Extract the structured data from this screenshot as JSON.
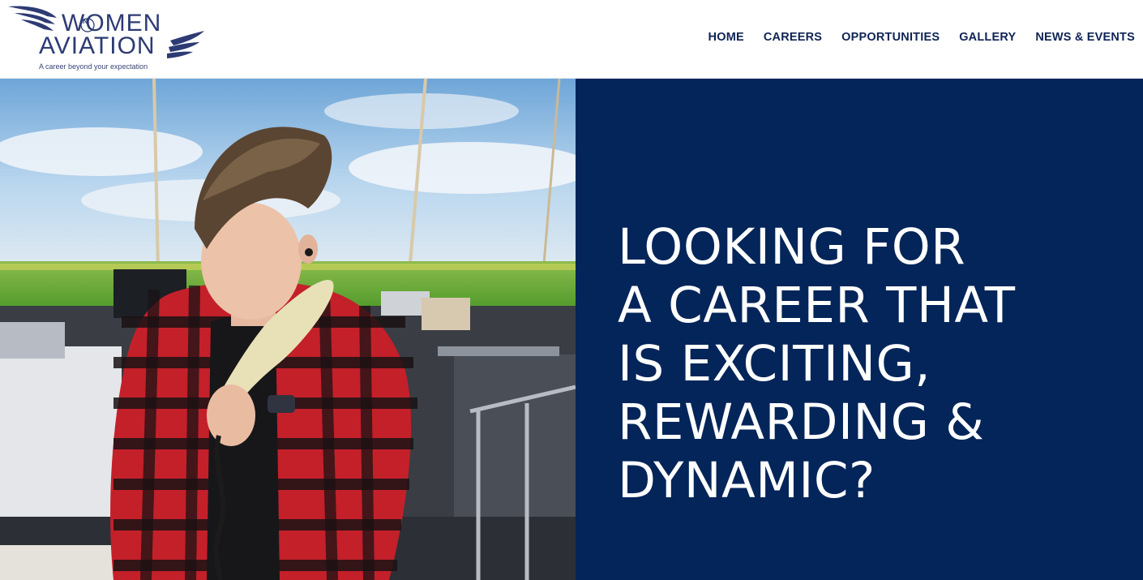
{
  "brand": {
    "line1": "WOMEN",
    "small": "IN",
    "line2": "AVIATION",
    "tagline": "A career beyond your expectation",
    "color": "#2d3b74"
  },
  "nav": {
    "items": [
      {
        "label": "HOME"
      },
      {
        "label": "CAREERS"
      },
      {
        "label": "OPPORTUNITIES"
      },
      {
        "label": "GALLERY"
      },
      {
        "label": "NEWS & EVENTS"
      }
    ],
    "color": "#0f2456"
  },
  "hero": {
    "panel_color": "#032559",
    "headline_lines": [
      "LOOKING FOR",
      "A CAREER THAT",
      "IS EXCITING,",
      "REWARDING &",
      "DYNAMIC?"
    ],
    "photo_icon": "air-traffic-controller-photo"
  }
}
